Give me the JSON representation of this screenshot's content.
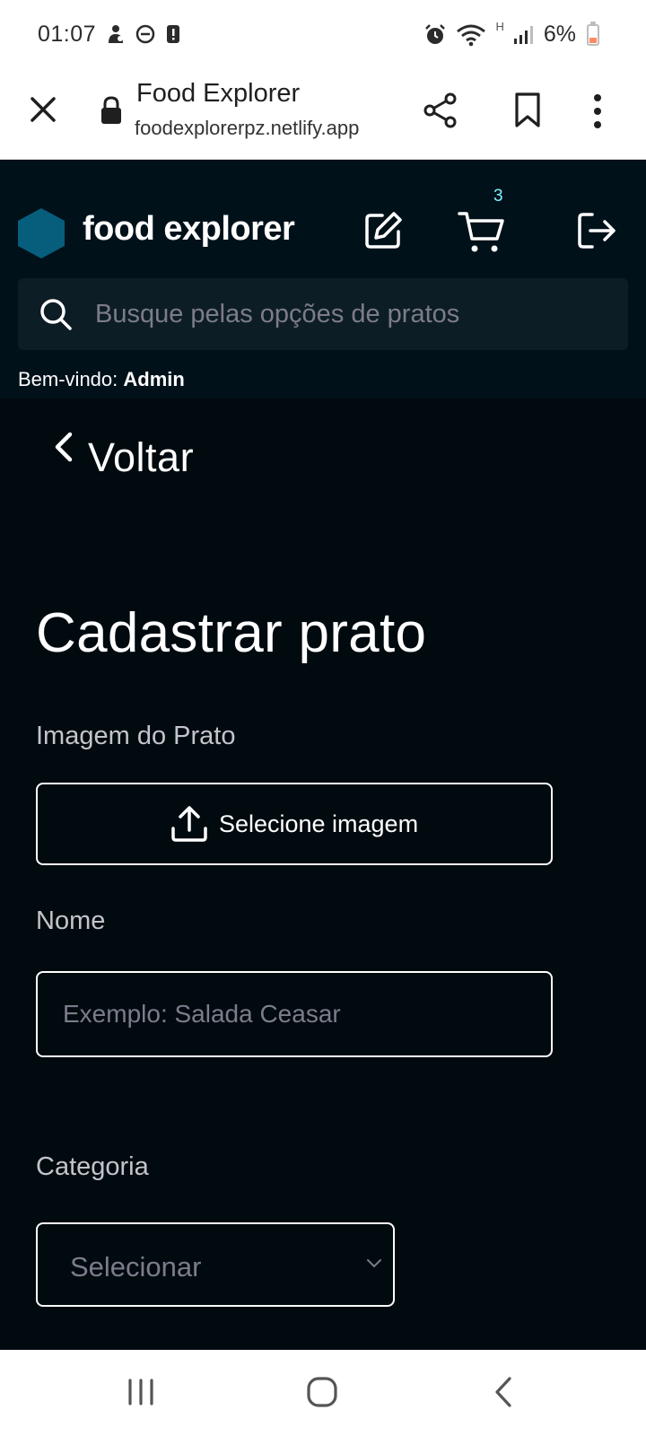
{
  "status_bar": {
    "time": "01:07",
    "network_indicator": "H",
    "battery_percent": "6%",
    "icons": [
      "notification-icon",
      "dnd-icon",
      "alert-icon",
      "alarm-icon",
      "wifi-icon",
      "signal-icon",
      "battery-icon"
    ]
  },
  "browser": {
    "title": "Food Explorer",
    "url": "foodexplorerpz.netlify.app",
    "icons": [
      "close-icon",
      "lock-icon",
      "share-icon",
      "bookmark-icon",
      "more-vert-icon"
    ]
  },
  "header": {
    "brand": "food explorer",
    "cart_count": "3",
    "search_placeholder": "Busque pelas opções de pratos",
    "welcome_prefix": "Bem-vindo: ",
    "welcome_user": "Admin",
    "icons": [
      "hexagon-logo-icon",
      "edit-icon",
      "cart-icon",
      "logout-icon",
      "search-icon"
    ]
  },
  "colors": {
    "background": "#000A0F",
    "header": "#00111A",
    "search_bg": "#0D1D25",
    "logo": "#065E7C",
    "cart_badge": "#82F3FF",
    "placeholder": "#7C7C8A"
  },
  "main": {
    "back_label": "Voltar",
    "page_title": "Cadastrar prato",
    "image_label": "Imagem do Prato",
    "upload_button": "Selecione imagem",
    "name_label": "Nome",
    "name_placeholder": "Exemplo: Salada Ceasar",
    "category_label": "Categoria",
    "category_value": "Selecionar"
  },
  "nav_bar": {
    "icons": [
      "recents-icon",
      "home-icon",
      "back-icon"
    ]
  }
}
